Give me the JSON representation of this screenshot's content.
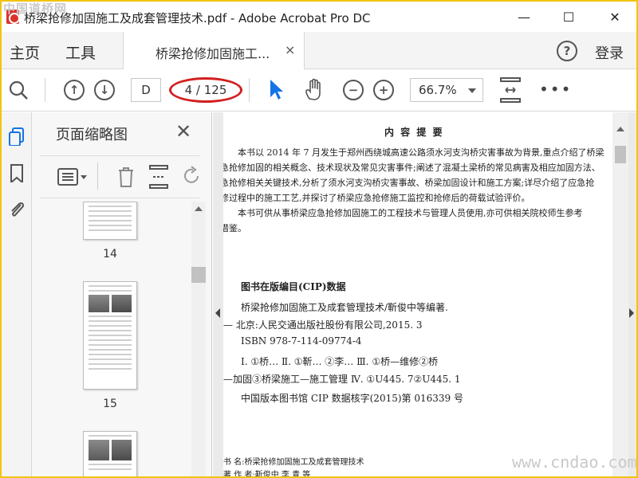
{
  "window": {
    "title": "桥梁抢修加固施工及成套管理技术.pdf - Adobe Acrobat Pro DC",
    "watermark_top": "中国道桥网",
    "minimize": "—",
    "maximize": "☐",
    "close": "✕"
  },
  "menu": {
    "home": "主页",
    "tools": "工具",
    "doc_tab": "桥梁抢修加固施工...",
    "doc_tab_close": "×",
    "help": "?",
    "login": "登录"
  },
  "toolbar": {
    "page_input": "D",
    "page_count": "4 / 125",
    "zoom": "66.7%",
    "more": "•••"
  },
  "thumbnails_panel": {
    "title": "页面缩略图",
    "close": "✕",
    "pages": [
      "14",
      "15"
    ]
  },
  "document": {
    "heading": "内 容 提 要",
    "para1": [
      "本书以 2014 年 7 月发生于郑州西绕城高速公路须水河支沟桥灾害事故为背景,重点介绍了桥梁",
      "急抢修加固的相关概念、技术现状及常见灾害事件;阐述了混凝土梁桥的常见病害及相应加固方法、",
      "急抢修相关关键技术,分析了须水河支沟桥灾害事故、桥梁加固设计和施工方案;详尽介绍了应急抢",
      "修过程中的施工工艺,并探讨了桥梁应急抢修施工监控和抢修后的荷载试验评价。"
    ],
    "para2": [
      "本书可供从事桥梁应急抢修加固施工的工程技术与管理人员使用,亦可供相关院校师生参考",
      "借鉴。"
    ],
    "cip_heading": "图书在版编目(CIP)数据",
    "cip_lines": [
      "桥梁抢修加固施工及成套管理技术/靳俊中等编著.",
      "— 北京:人民交通出版社股份有限公司,2015. 3",
      "ISBN  978-7-114-09774-4",
      "Ⅰ. ①桥… Ⅱ. ①靳… ②李… Ⅲ. ①桥—维修②桥",
      "—加固③桥梁施工—施工管理 Ⅳ. ①U445. 7②U445. 1",
      "中国版本图书馆 CIP 数据核字(2015)第 016339 号"
    ],
    "footer_lines": [
      "书    名:桥梁抢修加固施工及成套管理技术",
      "著 作 者:靳俊中   李   青   等"
    ],
    "watermark_br": "www.cndao.com"
  },
  "colors": {
    "frame": "#f1c40f",
    "select_arrow": "#1473e6",
    "highlight_circle": "#d21f1f",
    "active_nav": "#1473e6"
  }
}
